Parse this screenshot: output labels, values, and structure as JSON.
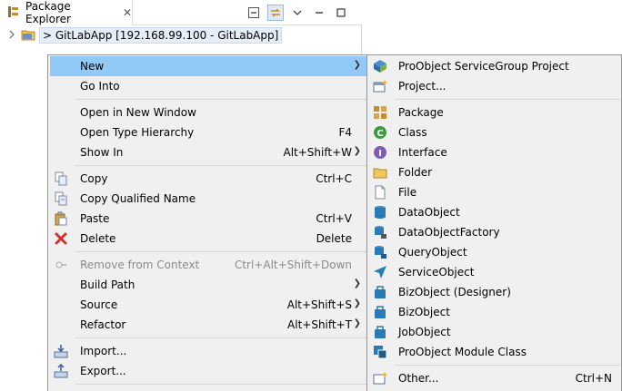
{
  "explorer": {
    "tab_title": "Package Explorer",
    "tab_close": "✕",
    "tree_item": "> GitLabApp [192.168.99.100 - GitLabApp]"
  },
  "context_menu": {
    "items": [
      {
        "label": "New",
        "accel": "",
        "submenu": true
      },
      {
        "label": "Go Into",
        "accel": ""
      },
      {
        "label": "Open in New Window",
        "accel": ""
      },
      {
        "label": "Open Type Hierarchy",
        "accel": "F4"
      },
      {
        "label": "Show In",
        "accel": "Alt+Shift+W",
        "submenu": true
      },
      {
        "label": "Copy",
        "accel": "Ctrl+C"
      },
      {
        "label": "Copy Qualified Name",
        "accel": ""
      },
      {
        "label": "Paste",
        "accel": "Ctrl+V"
      },
      {
        "label": "Delete",
        "accel": "Delete"
      },
      {
        "label": "Remove from Context",
        "accel": "Ctrl+Alt+Shift+Down",
        "disabled": true
      },
      {
        "label": "Build Path",
        "accel": "",
        "submenu": true
      },
      {
        "label": "Source",
        "accel": "Alt+Shift+S",
        "submenu": true
      },
      {
        "label": "Refactor",
        "accel": "Alt+Shift+T",
        "submenu": true
      },
      {
        "label": "Import...",
        "accel": ""
      },
      {
        "label": "Export...",
        "accel": ""
      }
    ]
  },
  "new_menu": {
    "items": [
      {
        "label": "ProObject ServiceGroup Project",
        "accel": ""
      },
      {
        "label": "Project...",
        "accel": ""
      },
      {
        "label": "Package",
        "accel": ""
      },
      {
        "label": "Class",
        "accel": ""
      },
      {
        "label": "Interface",
        "accel": ""
      },
      {
        "label": "Folder",
        "accel": ""
      },
      {
        "label": "File",
        "accel": ""
      },
      {
        "label": "DataObject",
        "accel": ""
      },
      {
        "label": "DataObjectFactory",
        "accel": ""
      },
      {
        "label": "QueryObject",
        "accel": ""
      },
      {
        "label": "ServiceObject",
        "accel": ""
      },
      {
        "label": "BizObject (Designer)",
        "accel": ""
      },
      {
        "label": "BizObject",
        "accel": ""
      },
      {
        "label": "JobObject",
        "accel": ""
      },
      {
        "label": "ProObject Module Class",
        "accel": ""
      },
      {
        "label": "Other...",
        "accel": "Ctrl+N"
      }
    ]
  },
  "colors": {
    "highlight": "#91c9f7",
    "menu_bg": "#f0f0f0"
  }
}
